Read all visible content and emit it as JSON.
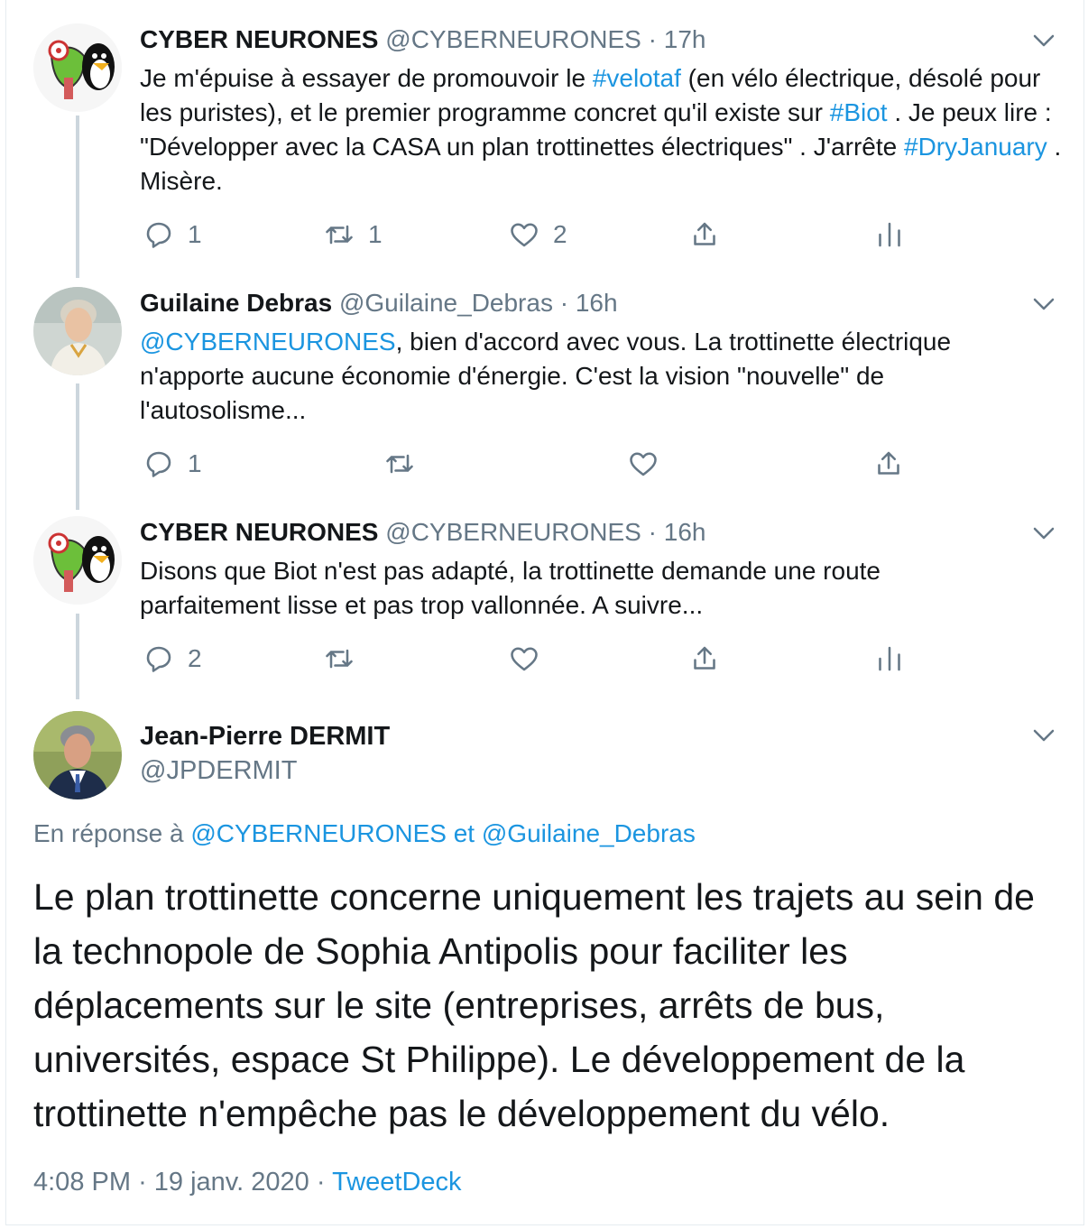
{
  "tweets": [
    {
      "name": "CYBER NEURONES",
      "handle": "@CYBERNEURONES",
      "sep": "·",
      "time": "17h",
      "text_1": "Je m'épuise à essayer de promouvoir le ",
      "hashtag_1": "#velotaf",
      "text_2": " (en vélo électrique, désolé pour les puristes), et le premier programme concret qu'il existe sur ",
      "hashtag_2": "#Biot",
      "text_3": " . Je peux lire : \"Développer avec la CASA un plan trottinettes électriques\" . J'arrête ",
      "hashtag_3": "#DryJanuary",
      "text_4": " . Misère.",
      "replies": "1",
      "retweets": "1",
      "likes": "2"
    },
    {
      "name": "Guilaine Debras",
      "handle": "@Guilaine_Debras",
      "sep": "·",
      "time": "16h",
      "mention": "@CYBERNEURONES",
      "text": ", bien d'accord avec vous. La trottinette électrique n'apporte aucune économie d'énergie. C'est la vision \"nouvelle\" de l'autosolisme...",
      "replies": "1"
    },
    {
      "name": "CYBER NEURONES",
      "handle": "@CYBERNEURONES",
      "sep": "·",
      "time": "16h",
      "text": "Disons que Biot n'est pas adapté, la trottinette demande une route parfaitement lisse et pas trop vallonnée. A suivre...",
      "replies": "2"
    }
  ],
  "main_tweet": {
    "name": "Jean-Pierre DERMIT",
    "handle": "@JPDERMIT",
    "reply_prefix": "En réponse à ",
    "reply_user_1": "@CYBERNEURONES",
    "reply_and": " et ",
    "reply_user_2": "@Guilaine_Debras",
    "text": "Le plan trottinette concerne uniquement les trajets au sein de la technopole de Sophia Antipolis pour faciliter les déplacements sur le site (entreprises, arrêts de bus, universités, espace St Philippe). Le développement de la trottinette n'empêche pas le développement du vélo.",
    "time": "4:08 PM",
    "sep1": "·",
    "date": "19 janv. 2020",
    "sep2": "·",
    "client": "TweetDeck"
  },
  "colors": {
    "link": "#1b95e0",
    "muted": "#657786",
    "text": "#14171a",
    "thread_line": "#ccd6dd"
  },
  "icons": [
    "reply-icon",
    "retweet-icon",
    "like-icon",
    "share-icon",
    "analytics-icon",
    "chevron-down-icon"
  ]
}
